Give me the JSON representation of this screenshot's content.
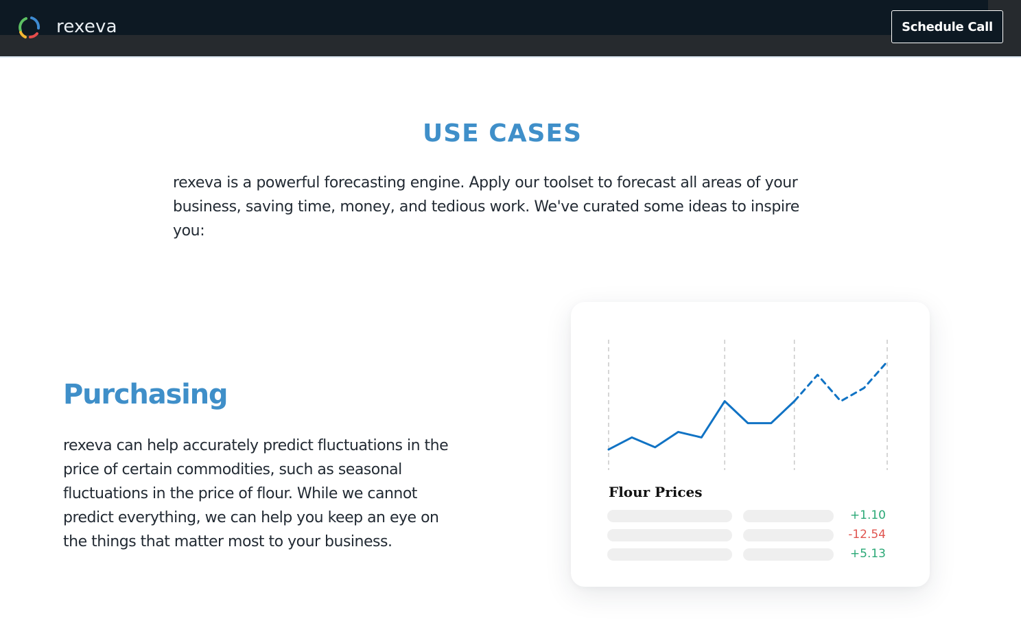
{
  "header": {
    "brand": "rexeva",
    "cta_label": "Schedule Call"
  },
  "section": {
    "title": "USE CASES",
    "intro": "rexeva is a powerful forecasting engine. Apply our toolset to forecast all areas of your business, saving time, money, and tedious work. We've curated some ideas to inspire you:"
  },
  "use_case": {
    "title": "Purchasing",
    "text": "rexeva can help accurately predict fluctuations in the price of certain commodities, such as seasonal fluctuations in the price of flour. While we cannot predict everything, we can help you keep an eye on the things that matter most to your business.",
    "card": {
      "title": "Flour Prices",
      "rows": [
        {
          "delta": "+1.10",
          "color": "#2aa876"
        },
        {
          "delta": "-12.54",
          "color": "#e0544f"
        },
        {
          "delta": "+5.13",
          "color": "#2aa876"
        }
      ]
    }
  },
  "chart_data": {
    "type": "line",
    "title": "",
    "xlabel": "",
    "ylabel": "",
    "grid": "vertical dashed lines",
    "series": [
      {
        "style": "solid",
        "color": "#1173c4",
        "points": [
          [
            0,
            0
          ],
          [
            1,
            0.11
          ],
          [
            2,
            0.02
          ],
          [
            3,
            0.16
          ],
          [
            4,
            0.11
          ],
          [
            5,
            0.44
          ],
          [
            6,
            0.24
          ],
          [
            7,
            0.24
          ],
          [
            8,
            0.44
          ]
        ]
      },
      {
        "style": "dashed",
        "color": "#1173c4",
        "points": [
          [
            8,
            0.44
          ],
          [
            9,
            0.68
          ],
          [
            10,
            0.44
          ],
          [
            11,
            0.56
          ],
          [
            12,
            0.8
          ]
        ]
      }
    ],
    "dividers": [
      0,
      5,
      8,
      12
    ]
  },
  "colors": {
    "accent": "#3f8fc9",
    "header_bg": "#0d1923",
    "positive": "#2aa876",
    "negative": "#e0544f",
    "line": "#1173c4"
  }
}
